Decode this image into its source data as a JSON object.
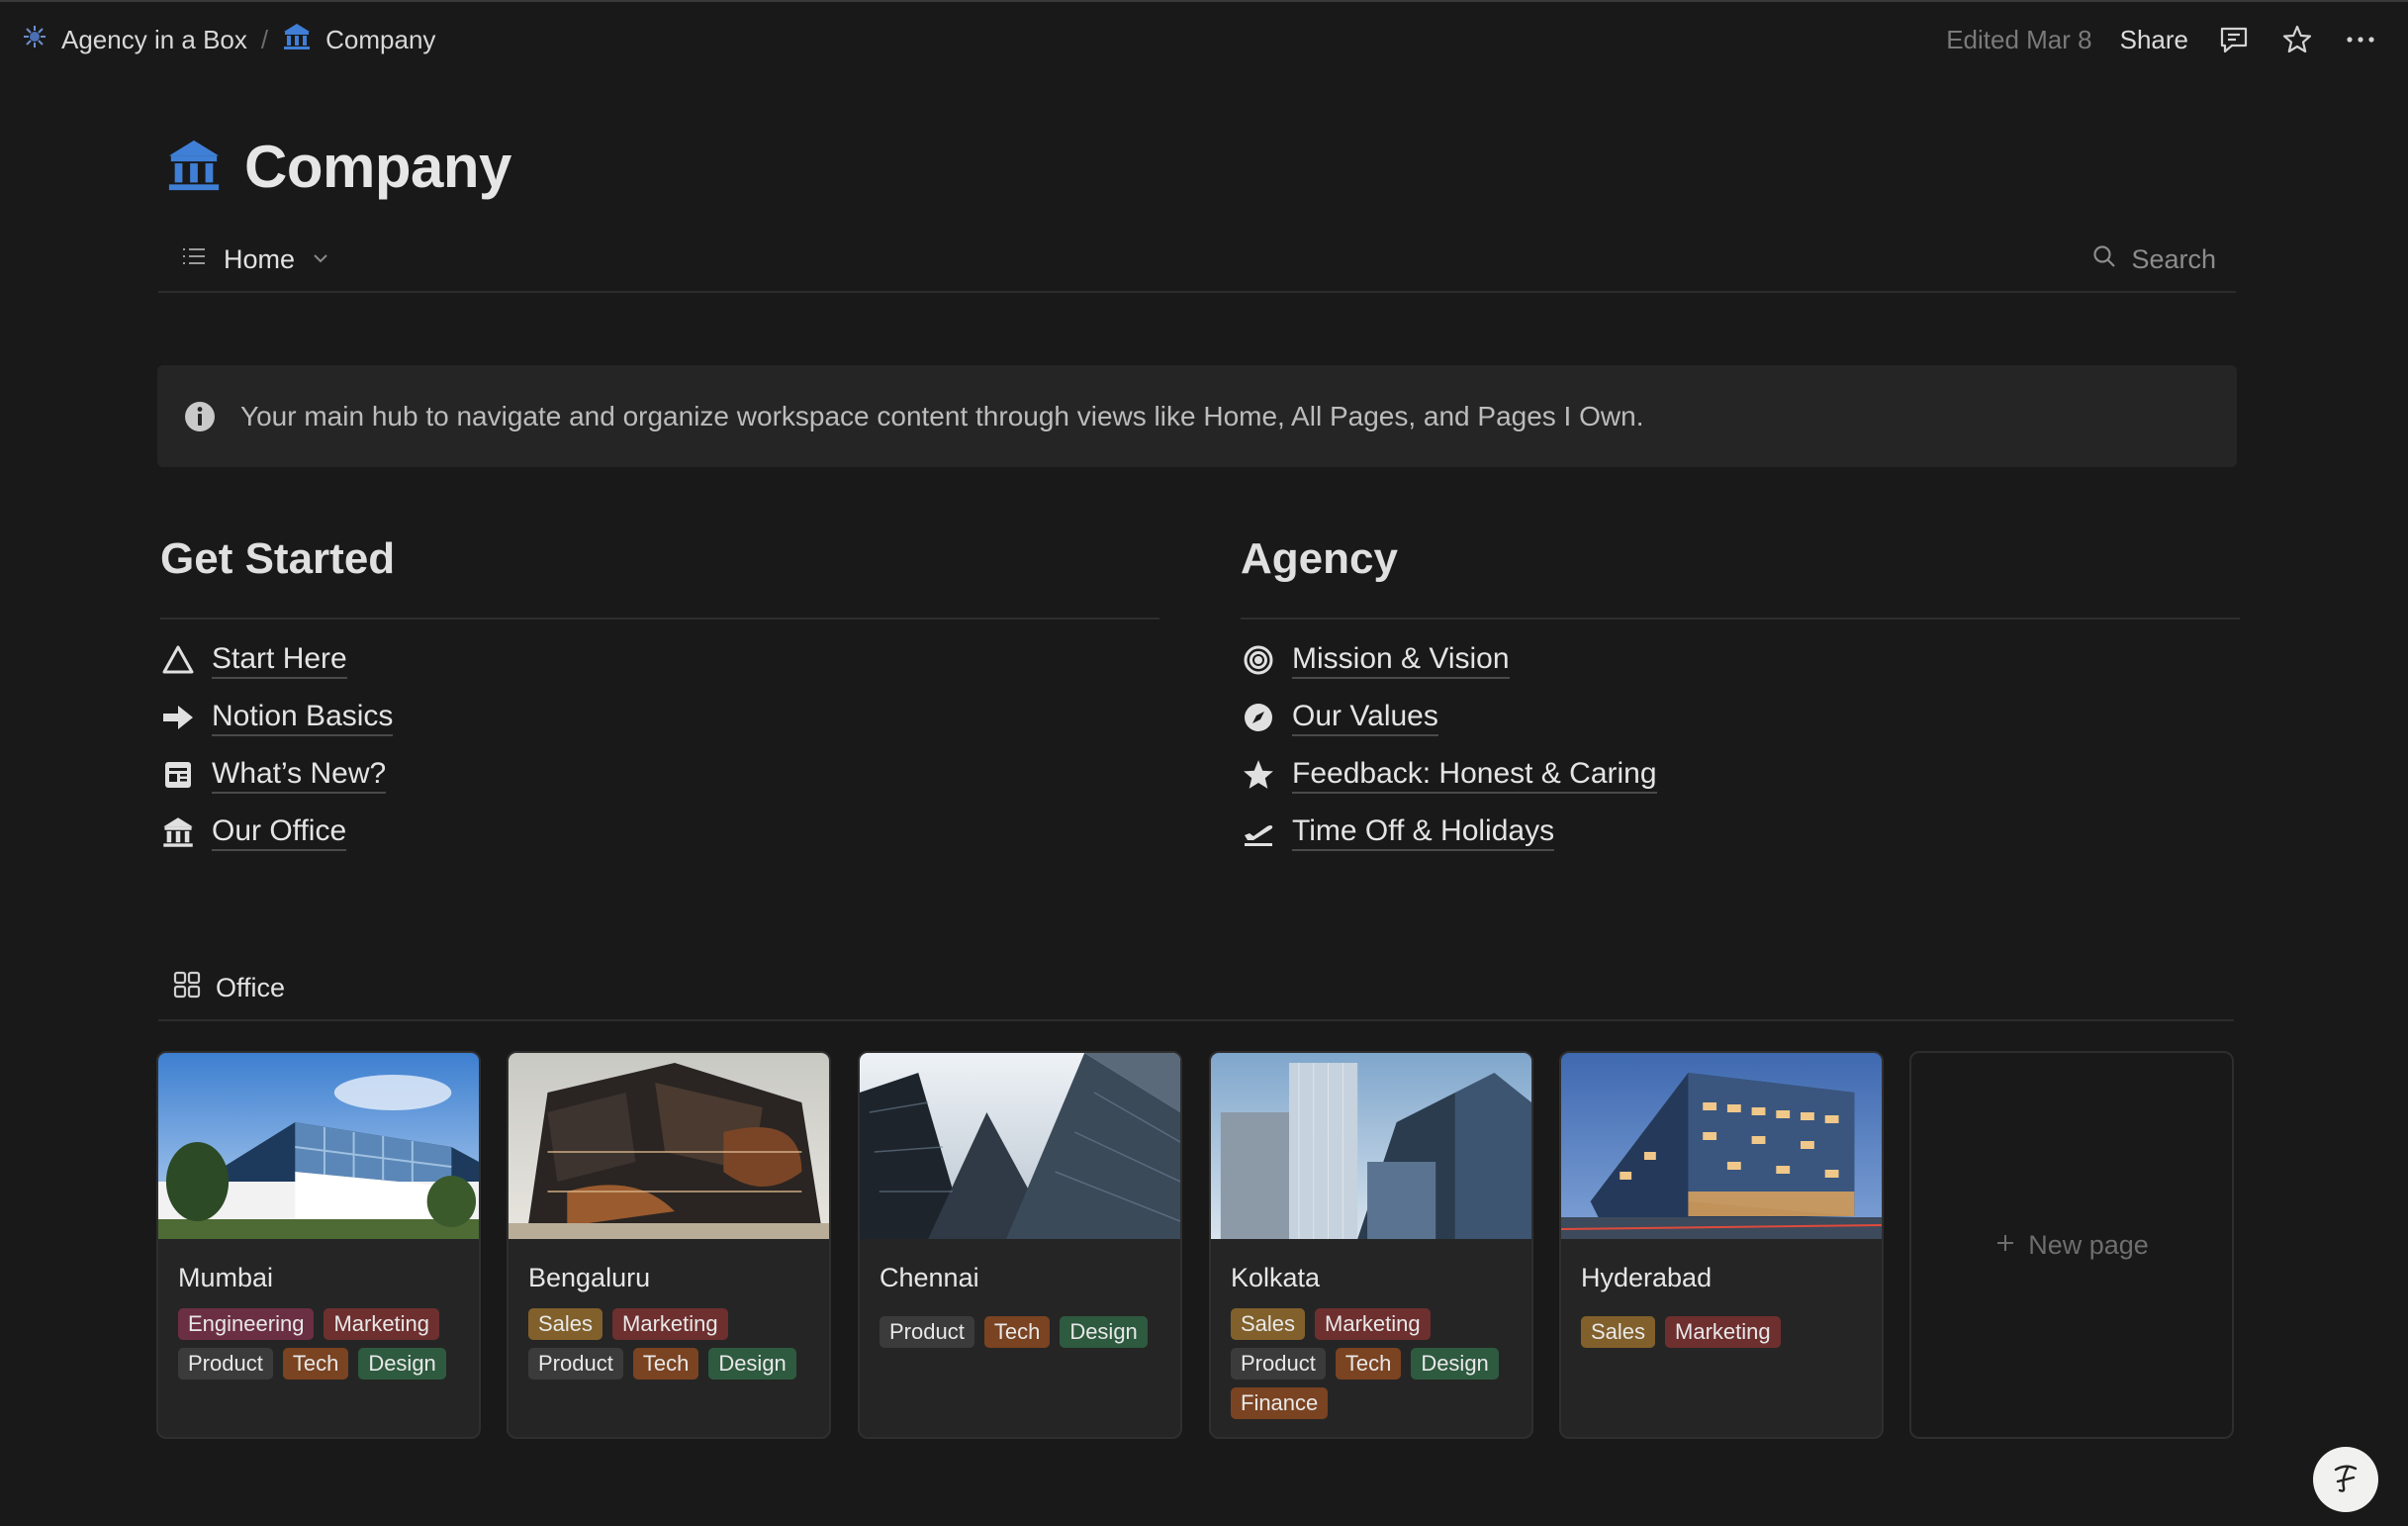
{
  "breadcrumb": {
    "workspace": "Agency in a Box",
    "separator": "/",
    "page": "Company"
  },
  "topbar": {
    "edited": "Edited Mar 8",
    "share_label": "Share"
  },
  "page": {
    "title": "Company",
    "icon": "bank-building-icon"
  },
  "view": {
    "tab_label": "Home",
    "search_label": "Search"
  },
  "callout": {
    "text": "Your main hub to navigate and organize workspace content through views like Home, All Pages, and Pages I Own."
  },
  "get_started": {
    "heading": "Get Started",
    "items": [
      {
        "label": "Start Here",
        "icon": "warning-triangle-icon"
      },
      {
        "label": "Notion Basics",
        "icon": "arrow-right-icon"
      },
      {
        "label": "What’s New?",
        "icon": "newsletter-icon"
      },
      {
        "label": "Our Office",
        "icon": "bank-building-icon"
      }
    ]
  },
  "agency": {
    "heading": "Agency",
    "items": [
      {
        "label": "Mission & Vision",
        "icon": "target-icon"
      },
      {
        "label": "Our Values",
        "icon": "compass-icon"
      },
      {
        "label": "Feedback: Honest & Caring",
        "icon": "star-icon"
      },
      {
        "label": "Time Off & Holidays",
        "icon": "airplane-takeoff-icon"
      }
    ]
  },
  "office": {
    "tab_label": "Office",
    "cards": [
      {
        "name": "Mumbai",
        "tags": [
          "Engineering",
          "Marketing",
          "Product",
          "Tech",
          "Design"
        ]
      },
      {
        "name": "Bengaluru",
        "tags": [
          "Sales",
          "Marketing",
          "Product",
          "Tech",
          "Design"
        ]
      },
      {
        "name": "Chennai",
        "tags": [
          "Product",
          "Tech",
          "Design"
        ]
      },
      {
        "name": "Kolkata",
        "tags": [
          "Sales",
          "Marketing",
          "Product",
          "Tech",
          "Design",
          "Finance"
        ]
      },
      {
        "name": "Hyderabad",
        "tags": [
          "Sales",
          "Marketing"
        ]
      }
    ],
    "new_page_label": "New page"
  },
  "colors": {
    "background": "#191919",
    "accent_icon": "#3f7fd6",
    "callout_bg": "#252525"
  }
}
